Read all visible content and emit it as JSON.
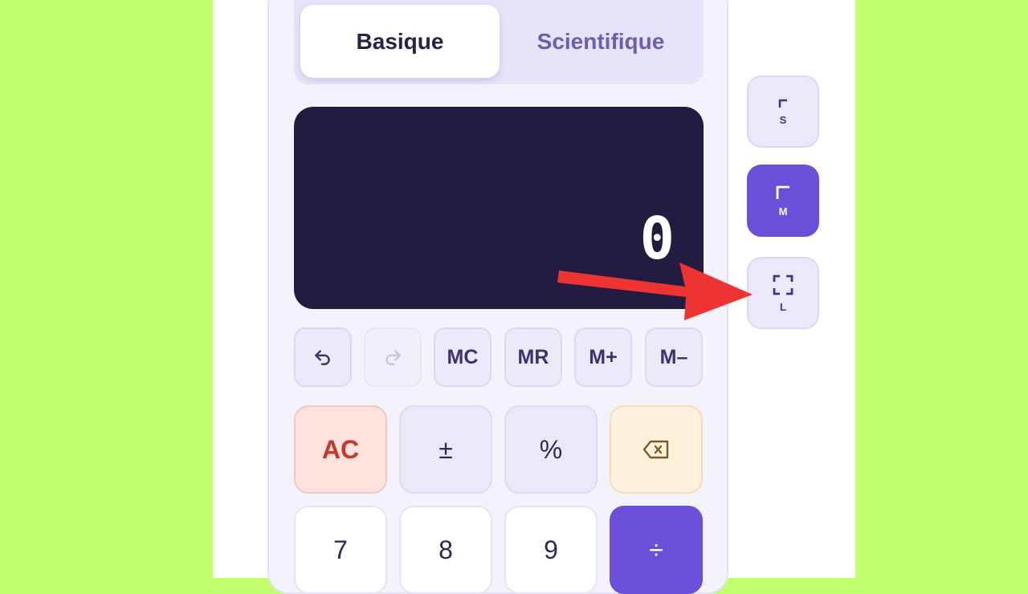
{
  "tabs": {
    "basic": "Basique",
    "scientific": "Scientifique",
    "active": "basic"
  },
  "display": {
    "value": "0"
  },
  "memory_row": {
    "undo_icon": "undo-icon",
    "redo_icon": "redo-icon",
    "mc": "MC",
    "mr": "MR",
    "m_plus": "M+",
    "m_minus": "M–"
  },
  "keys": {
    "ac": "AC",
    "sign": "±",
    "percent": "%",
    "backspace_icon": "backspace-icon",
    "seven": "7",
    "eight": "8",
    "nine": "9",
    "divide": "÷"
  },
  "size_buttons": [
    {
      "label": "S",
      "active": false
    },
    {
      "label": "M",
      "active": true
    },
    {
      "label": "L",
      "active": false
    }
  ],
  "colors": {
    "background": "#c1fd6f",
    "accent": "#6c4fd8",
    "display_bg": "#241c40",
    "annotation_arrow": "#ee3333"
  }
}
